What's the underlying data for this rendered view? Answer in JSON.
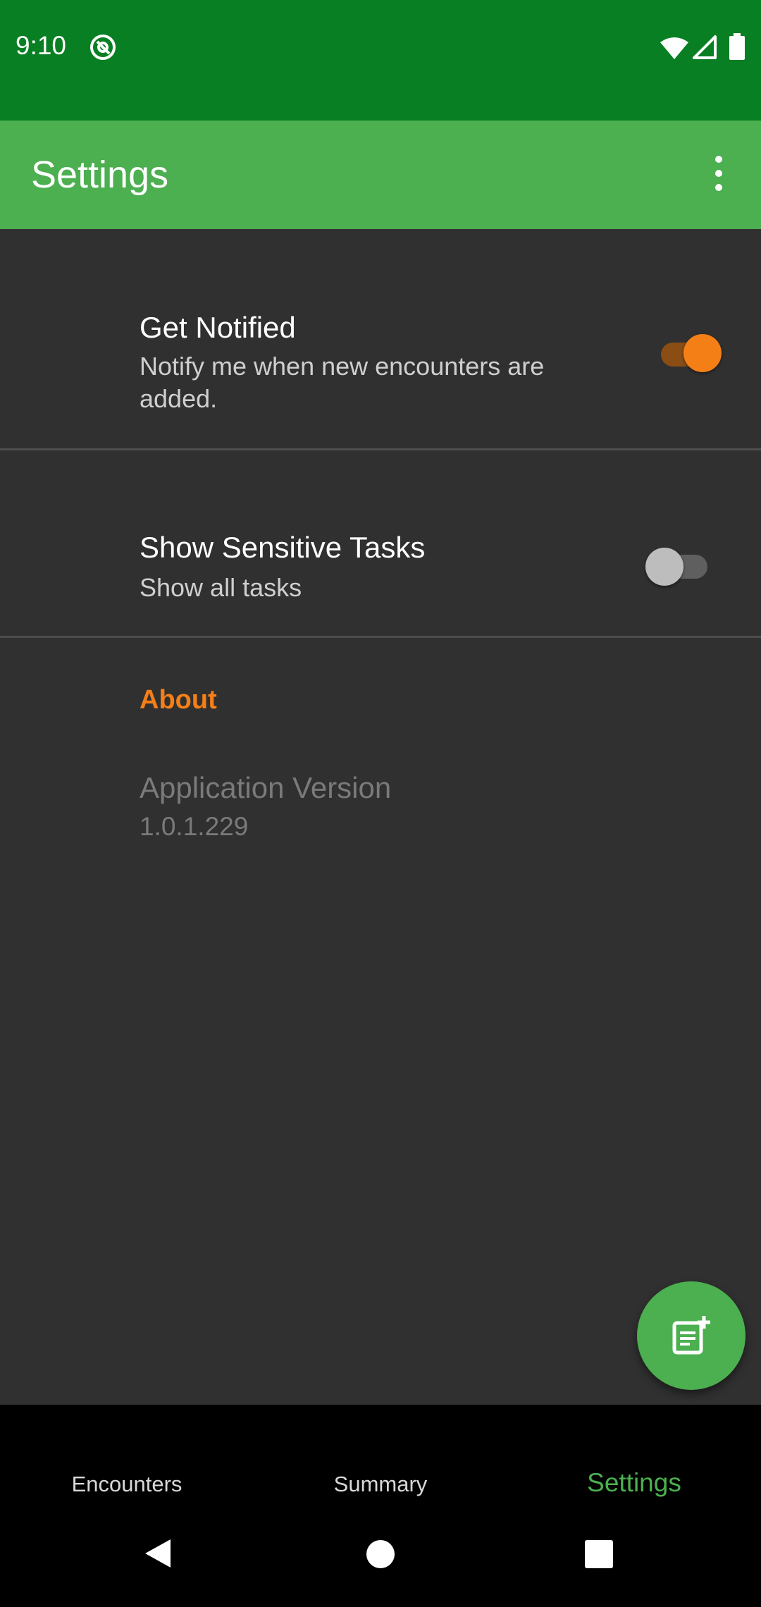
{
  "status_bar": {
    "time": "9:10",
    "icons": [
      "at-sign-icon",
      "wifi-icon",
      "signal-icon",
      "battery-icon"
    ]
  },
  "app_bar": {
    "title": "Settings",
    "menu_icon": "more-vert-icon"
  },
  "preferences": [
    {
      "title": "Get Notified",
      "summary": "Notify me when new encounters are added.",
      "enabled": true
    },
    {
      "title": "Show Sensitive Tasks",
      "summary": "Show all tasks",
      "enabled": false
    }
  ],
  "about": {
    "section_title": "About",
    "version_label": "Application Version",
    "version_value": "1.0.1.229"
  },
  "fab": {
    "icon": "note-add-icon"
  },
  "bottom_nav": {
    "items": [
      {
        "label": "Encounters",
        "active": false
      },
      {
        "label": "Summary",
        "active": false
      },
      {
        "label": "Settings",
        "active": true
      }
    ]
  },
  "system_nav": [
    "back-icon",
    "home-icon",
    "recents-icon"
  ],
  "colors": {
    "status_bar": "#087f23",
    "app_bar": "#4caf50",
    "background": "#303030",
    "accent": "#f57f17",
    "nav_active": "#4caf50"
  }
}
